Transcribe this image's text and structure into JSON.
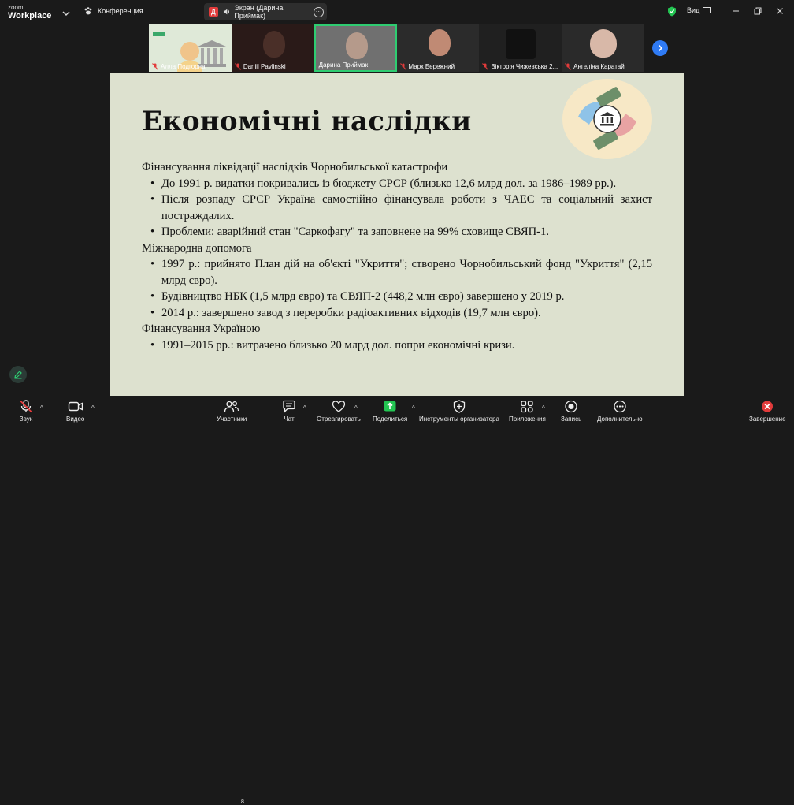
{
  "app": {
    "logo_top": "zoom",
    "logo_bottom": "Workplace",
    "meeting_label": "Конференция",
    "share_initial": "Д",
    "share_label": "Экран (Дарина Приймак)",
    "view_label": "Вид"
  },
  "participants": [
    {
      "name": "Алла Подгорна"
    },
    {
      "name": "Daniil Pavlinski"
    },
    {
      "name": "Дарина Приймак"
    },
    {
      "name": "Марк Бережний"
    },
    {
      "name": "Вікторія Чижевська 2..."
    },
    {
      "name": "Ангеліна Каратай"
    }
  ],
  "slide": {
    "title": "Економічні наслідки",
    "sections": [
      {
        "heading": "Фінансування ліквідації наслідків Чорнобильської катастрофи",
        "bullets": [
          "До 1991 р. видатки покривались із бюджету СРСР (близько 12,6 млрд дол. за 1986–1989 рр.).",
          "Після розпаду СРСР Україна самостійно фінансувала роботи з ЧАЕС та соціальний захист постраждалих.",
          "Проблеми: аварійний стан \"Саркофагу\" та заповнене на 99% сховище СВЯП-1."
        ]
      },
      {
        "heading": "Міжнародна допомога",
        "bullets": [
          "1997 р.: прийнято План дій на об'єкті \"Укриття\"; створено Чорнобильський фонд \"Укриття\" (2,15 млрд євро).",
          "Будівництво НБК (1,5 млрд євро) та СВЯП-2 (448,2 млн євро) завершено у 2019 р.",
          "2014 р.: завершено завод з переробки радіоактивних відходів (19,7 млн євро)."
        ]
      },
      {
        "heading": "Фінансування Україною",
        "bullets": [
          "1991–2015 рр.: витрачено близько 20 млрд дол. попри економічні кризи."
        ]
      }
    ]
  },
  "toolbar": {
    "audio": "Звук",
    "video": "Видео",
    "participants": "Участники",
    "participants_count": "8",
    "chat": "Чат",
    "react": "Отреагировать",
    "share": "Поделиться",
    "host_tools": "Инструменты организатора",
    "apps": "Приложения",
    "record": "Запись",
    "more": "Дополнительно",
    "end": "Завершение"
  },
  "colors": {
    "accent_green": "#2ecc71",
    "share_green": "#23c552",
    "slide_bg": "#dde1cf",
    "end_red": "#e23b3b",
    "next_blue": "#2f7bf5"
  }
}
